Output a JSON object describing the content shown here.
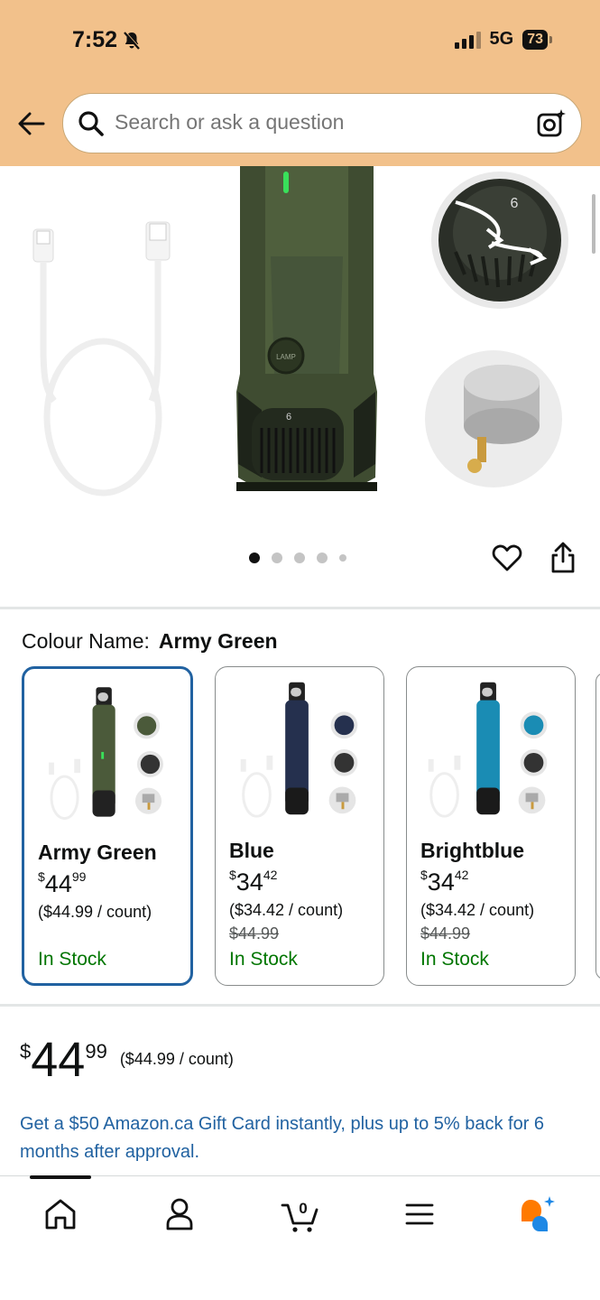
{
  "status_bar": {
    "time": "7:52",
    "network": "5G",
    "battery": "73"
  },
  "search": {
    "placeholder": "Search or ask a question"
  },
  "gallery": {
    "lamp_label": "LAMP",
    "dial_number": "6",
    "dial_number_zoom": "6",
    "page_count": 5,
    "active_page": 1
  },
  "colour": {
    "label": "Colour Name:",
    "selected": "Army Green"
  },
  "variants": [
    {
      "name": "Army Green",
      "currency": "$",
      "whole": "44",
      "fraction": "99",
      "unit_price": "($44.99 / count)",
      "list_price": "",
      "stock": "In Stock",
      "color": "#4b5a3a",
      "accent": "#3a4a30"
    },
    {
      "name": "Blue",
      "currency": "$",
      "whole": "34",
      "fraction": "42",
      "unit_price": "($34.42 / count)",
      "list_price": "$44.99",
      "stock": "In Stock",
      "color": "#25304e",
      "accent": "#1b2440"
    },
    {
      "name": "Brightblue",
      "currency": "$",
      "whole": "34",
      "fraction": "42",
      "unit_price": "($34.42 / count)",
      "list_price": "$44.99",
      "stock": "In Stock",
      "color": "#1a8cb4",
      "accent": "#0f6f92"
    }
  ],
  "price": {
    "currency": "$",
    "whole": "44",
    "fraction": "99",
    "unit": "($44.99 / count)"
  },
  "promo": "Get a $50 Amazon.ca Gift Card instantly, plus up to 5% back for 6 months after approval.",
  "nav": {
    "cart_count": "0"
  },
  "colors": {
    "header": "#f2c18b",
    "link": "#2162a1",
    "in_stock": "#007600",
    "selected_border": "#2162a1"
  }
}
